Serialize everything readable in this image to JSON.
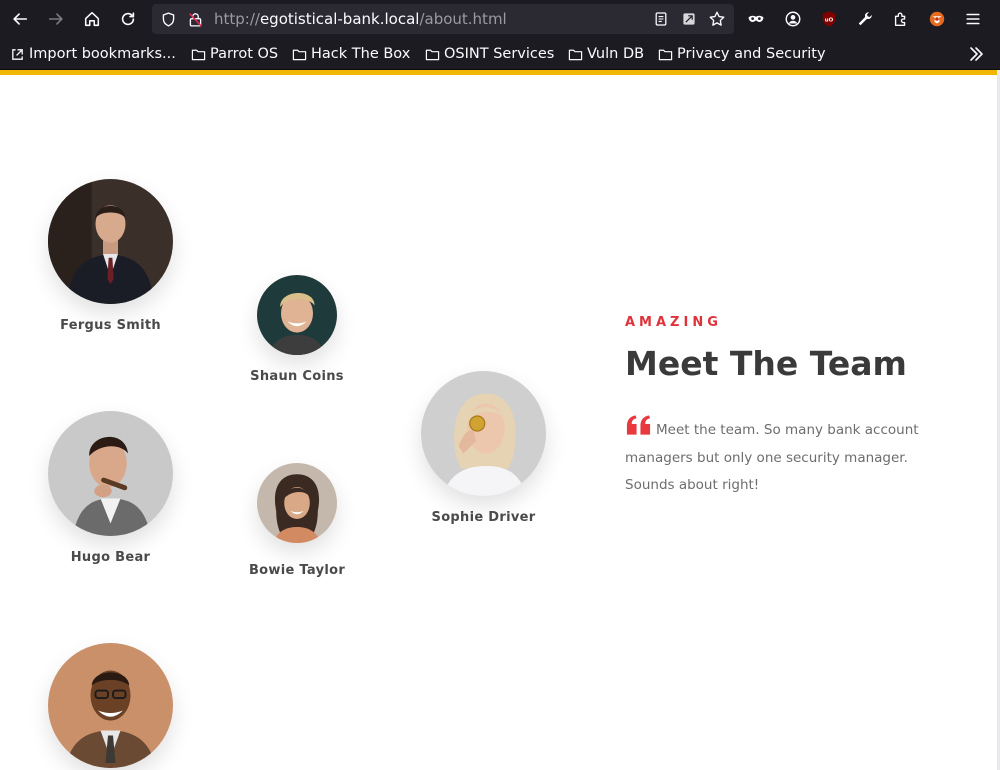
{
  "browser": {
    "url_scheme": "http://",
    "url_host": "egotistical-bank.local",
    "url_path": "/about.html",
    "bookmarks": [
      {
        "label": "Import bookmarks..."
      },
      {
        "label": "Parrot OS"
      },
      {
        "label": "Hack The Box"
      },
      {
        "label": "OSINT Services"
      },
      {
        "label": "Vuln DB"
      },
      {
        "label": "Privacy and Security"
      }
    ],
    "accent_color": "#f2b705"
  },
  "team": {
    "kicker": "AMAZING",
    "title": "Meet The Team",
    "quote": "Meet the team. So many bank account managers but only one security manager. Sounds about right!",
    "accent_color": "#e0323a",
    "members": [
      {
        "name": "Fergus Smith"
      },
      {
        "name": "Shaun Coins"
      },
      {
        "name": "Hugo Bear"
      },
      {
        "name": "Bowie Taylor"
      },
      {
        "name": "Sophie Driver"
      },
      {
        "name": ""
      }
    ]
  }
}
